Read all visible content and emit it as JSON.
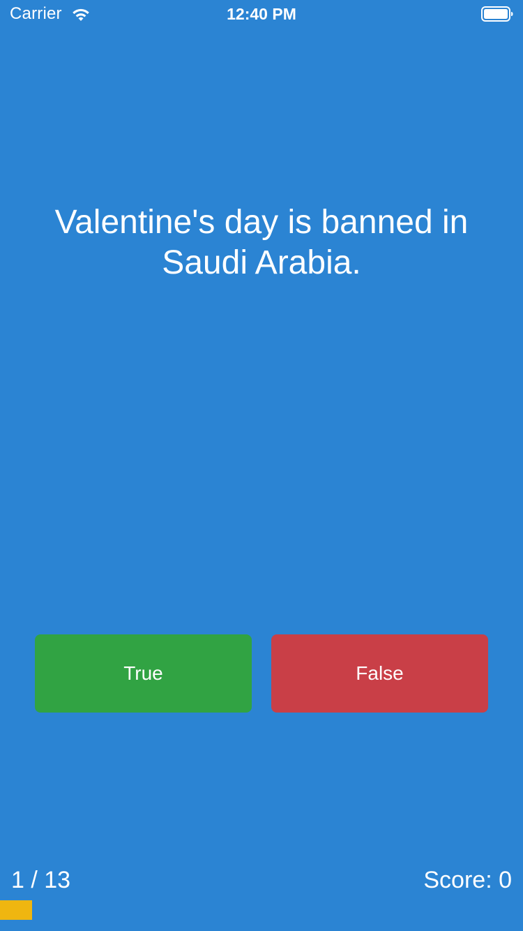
{
  "status_bar": {
    "carrier": "Carrier",
    "time": "12:40 PM",
    "wifi_icon": "wifi-icon",
    "battery_icon": "battery-icon"
  },
  "question": {
    "text": "Valentine's day is banned in Saudi Arabia."
  },
  "answers": {
    "true_label": "True",
    "false_label": "False"
  },
  "footer": {
    "progress_text": "1 / 13",
    "score_text": "Score: 0",
    "progress_fraction": 0.0615
  },
  "colors": {
    "background": "#2B84D3",
    "true_button": "#31A343",
    "false_button": "#C93F47",
    "progress_bar": "#EFB610"
  }
}
